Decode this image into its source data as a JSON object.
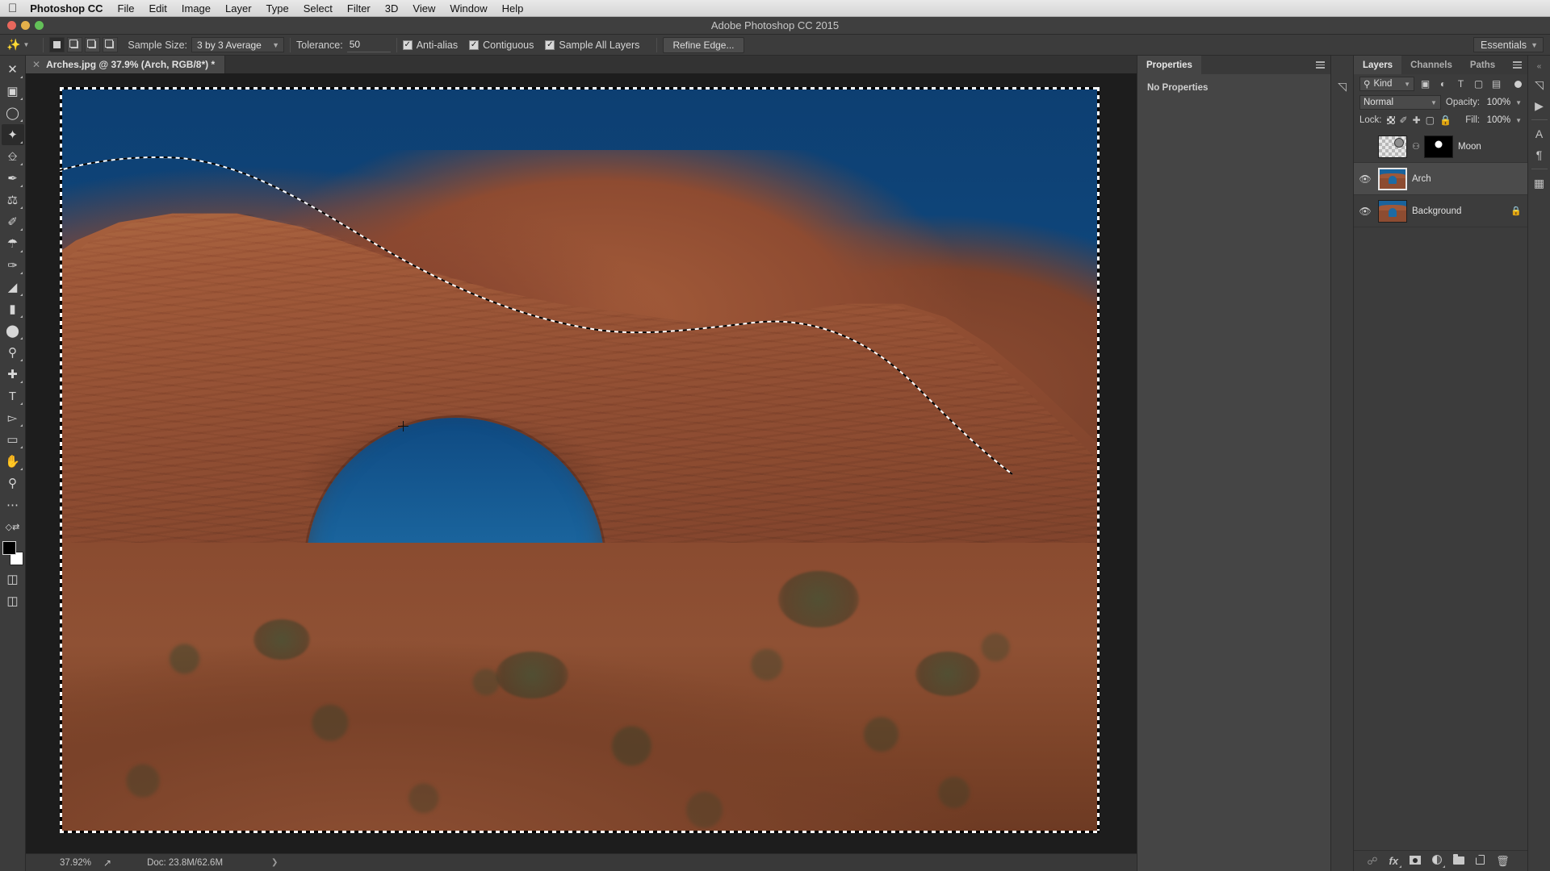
{
  "mac_menu": {
    "apple_icon": "apple-icon",
    "app_name": "Photoshop CC",
    "items": [
      "File",
      "Edit",
      "Image",
      "Layer",
      "Type",
      "Select",
      "Filter",
      "3D",
      "View",
      "Window",
      "Help"
    ]
  },
  "window": {
    "title": "Adobe Photoshop CC 2015"
  },
  "options_bar": {
    "tool_icon": "magic-wand-icon",
    "selection_modes": [
      "new-selection",
      "add-to-selection",
      "subtract-from-selection",
      "intersect-with-selection"
    ],
    "active_mode_index": 0,
    "sample_size_label": "Sample Size:",
    "sample_size_value": "3 by 3 Average",
    "tolerance_label": "Tolerance:",
    "tolerance_value": "50",
    "checkboxes": [
      {
        "label": "Anti-alias",
        "checked": true
      },
      {
        "label": "Contiguous",
        "checked": true
      },
      {
        "label": "Sample All Layers",
        "checked": true
      }
    ],
    "refine_edge_label": "Refine Edge...",
    "workspace_value": "Essentials"
  },
  "toolbar": {
    "tools": [
      {
        "name": "move-tool",
        "glyph": "✥",
        "has_flyout": true,
        "selected": false
      },
      {
        "name": "rectangular-marquee-tool",
        "glyph": "⬚",
        "has_flyout": true,
        "selected": false
      },
      {
        "name": "lasso-tool",
        "glyph": "◯",
        "has_flyout": true,
        "selected": false
      },
      {
        "name": "magic-wand-tool",
        "glyph": "✨",
        "has_flyout": true,
        "selected": true
      },
      {
        "name": "crop-tool",
        "glyph": "⌗",
        "has_flyout": true,
        "selected": false
      },
      {
        "name": "eyedropper-tool",
        "glyph": "✒",
        "has_flyout": true,
        "selected": false
      },
      {
        "name": "spot-healing-brush-tool",
        "glyph": "✚",
        "has_flyout": true,
        "selected": false
      },
      {
        "name": "brush-tool",
        "glyph": "🖌",
        "has_flyout": true,
        "selected": false
      },
      {
        "name": "clone-stamp-tool",
        "glyph": "⎈",
        "has_flyout": true,
        "selected": false
      },
      {
        "name": "history-brush-tool",
        "glyph": "🖍",
        "has_flyout": true,
        "selected": false
      },
      {
        "name": "eraser-tool",
        "glyph": "◣",
        "has_flyout": true,
        "selected": false
      },
      {
        "name": "gradient-tool",
        "glyph": "▭",
        "has_flyout": true,
        "selected": false
      },
      {
        "name": "blur-tool",
        "glyph": "💧",
        "has_flyout": true,
        "selected": false
      },
      {
        "name": "dodge-tool",
        "glyph": "🔍",
        "has_flyout": true,
        "selected": false
      },
      {
        "name": "pen-tool",
        "glyph": "✎",
        "has_flyout": true,
        "selected": false
      },
      {
        "name": "type-tool",
        "glyph": "T",
        "has_flyout": true,
        "selected": false
      },
      {
        "name": "path-selection-tool",
        "glyph": "⌲",
        "has_flyout": true,
        "selected": false
      },
      {
        "name": "rectangle-tool",
        "glyph": "▭",
        "has_flyout": true,
        "selected": false
      },
      {
        "name": "hand-tool",
        "glyph": "✋",
        "has_flyout": true,
        "selected": false
      },
      {
        "name": "zoom-tool",
        "glyph": "🔍",
        "has_flyout": false,
        "selected": false
      }
    ],
    "more_tools_icon": "ellipsis-icon",
    "quickmask_icon": "quick-mask-icon",
    "screenmode_icon": "screen-mode-icon",
    "foreground_color": "#000000",
    "background_color": "#ffffff"
  },
  "document": {
    "tab_title": "Arches.jpg @ 37.9% (Arch, RGB/8*) *",
    "close_icon": "close-icon"
  },
  "status_bar": {
    "zoom": "37.92%",
    "share_icon": "share-icon",
    "doc_info": "Doc: 23.8M/62.6M",
    "expand_icon": "chevron-right-icon"
  },
  "properties_panel": {
    "tabs": [
      {
        "label": "Properties",
        "active": true
      }
    ],
    "menu_icon": "panel-menu-icon",
    "empty_text": "No Properties"
  },
  "icon_rail": {
    "icons": [
      "history-panel-icon"
    ]
  },
  "layers_panel": {
    "tabs": [
      {
        "label": "Layers",
        "active": true
      },
      {
        "label": "Channels",
        "active": false
      },
      {
        "label": "Paths",
        "active": false
      }
    ],
    "menu_icon": "panel-menu-icon",
    "filter": {
      "search_icon": "search-icon",
      "kind_label": "Kind",
      "filter_icons": [
        "pixel-filter-icon",
        "adjustment-filter-icon",
        "type-filter-icon",
        "shape-filter-icon",
        "smartobject-filter-icon"
      ],
      "toggle_icon": "filter-toggle-icon"
    },
    "blend_mode": "Normal",
    "opacity_label": "Opacity:",
    "opacity_value": "100%",
    "lock_label": "Lock:",
    "lock_icons": [
      "lock-transparent-pixels-icon",
      "lock-image-pixels-icon",
      "lock-position-icon",
      "lock-artboard-nesting-icon",
      "lock-all-icon"
    ],
    "fill_label": "Fill:",
    "fill_value": "100%",
    "layers": [
      {
        "name": "Moon",
        "visible": false,
        "selected": false,
        "thumb_type": "transparent-with-moon",
        "has_mask": true,
        "mask_linked": true,
        "locked": false
      },
      {
        "name": "Arch",
        "visible": true,
        "selected": true,
        "thumb_type": "photo",
        "has_mask": false,
        "mask_linked": false,
        "locked": false
      },
      {
        "name": "Background",
        "visible": true,
        "selected": false,
        "thumb_type": "photo",
        "has_mask": false,
        "mask_linked": false,
        "locked": true
      }
    ],
    "footer_icons": [
      "link-layers-icon",
      "layer-style-fx-icon",
      "add-layer-mask-icon",
      "new-adjustment-layer-icon",
      "new-group-icon",
      "new-layer-icon",
      "delete-layer-icon"
    ]
  },
  "right_dock": {
    "icons": [
      "history-icon",
      "actions-play-icon",
      "character-icon",
      "paragraph-icon",
      "3d-icon"
    ],
    "collapse_icon": "collapse-panels-icon"
  },
  "canvas": {
    "image_subject": "Arches National Park rock arch under deep blue sky",
    "selection_active": true,
    "cursor_icon": "crosshair-cursor"
  },
  "colors": {
    "sky": "#0f4a7d",
    "rock": "#8d4c31",
    "panel_bg": "#3c3c3c",
    "panel_alt": "#454545",
    "canvas_bg": "#1d1d1d",
    "menu_bg": "#e4e4e4"
  }
}
